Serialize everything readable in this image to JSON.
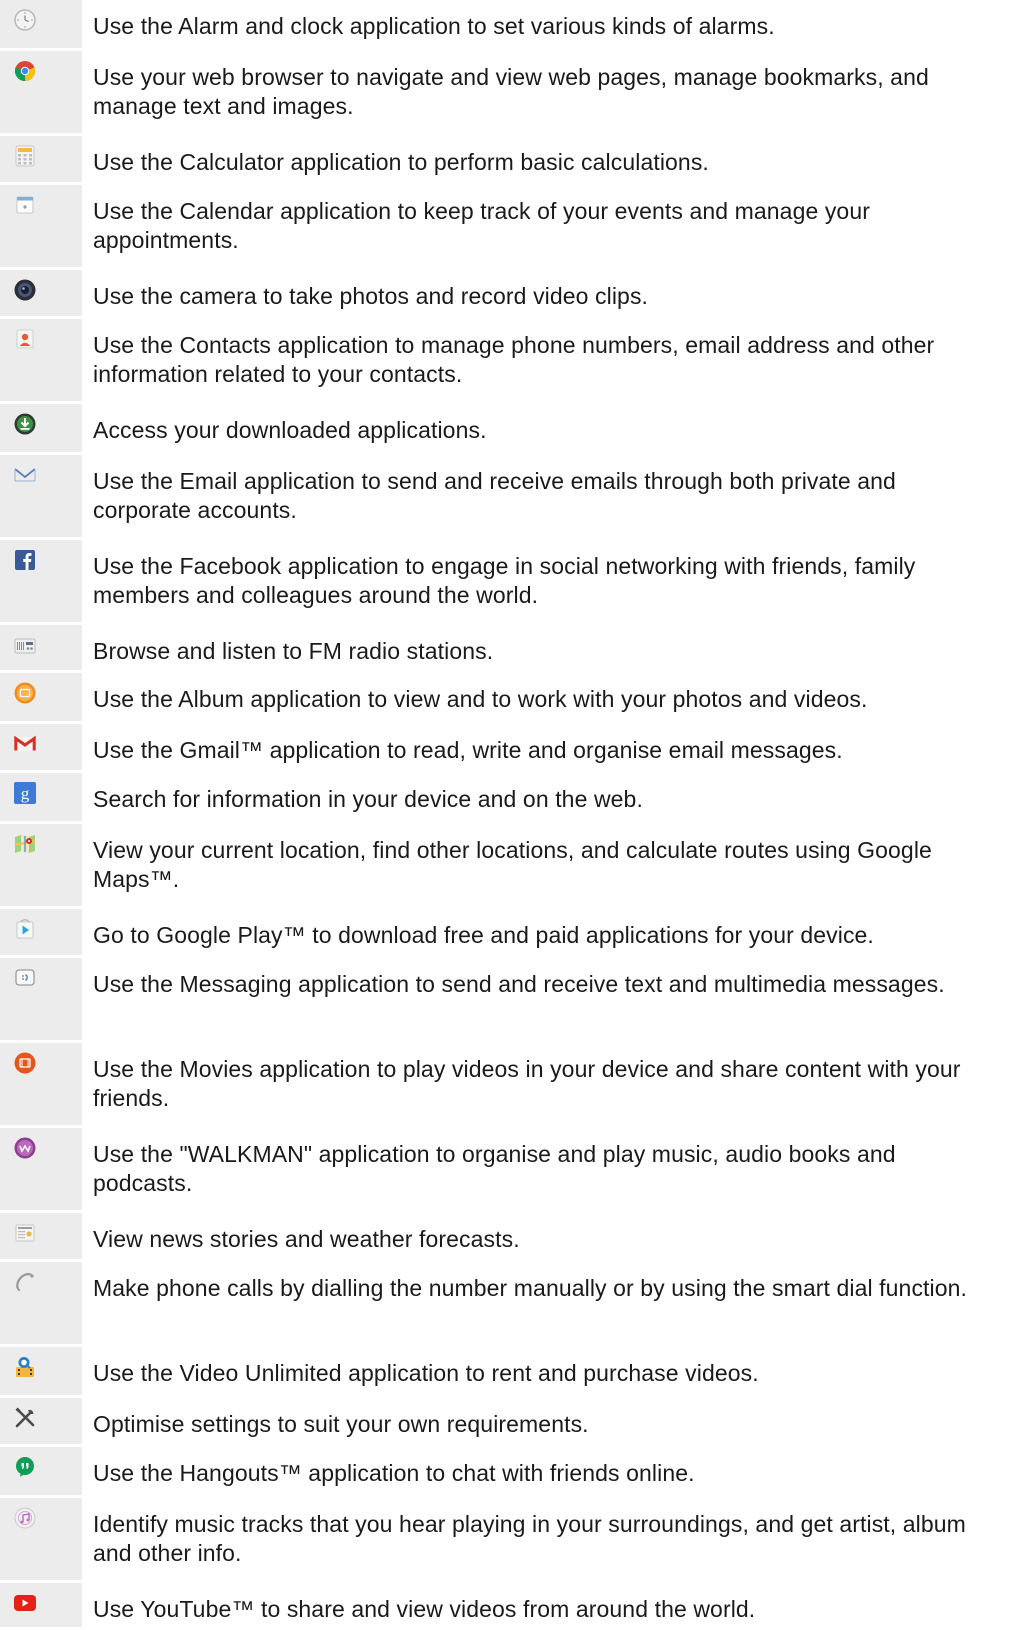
{
  "apps": [
    {
      "icon": "alarm-clock-icon",
      "description": "Use the Alarm and clock application to set various kinds of alarms."
    },
    {
      "icon": "browser-icon",
      "description": "Use your web browser to navigate and view web pages, manage bookmarks, and manage text and images."
    },
    {
      "icon": "calculator-icon",
      "description": "Use the Calculator application to perform basic calculations."
    },
    {
      "icon": "calendar-icon",
      "description": "Use the Calendar application to keep track of your events and manage your appointments."
    },
    {
      "icon": "camera-icon",
      "description": "Use the camera to take photos and record video clips."
    },
    {
      "icon": "contacts-icon",
      "description": "Use the Contacts application to manage phone numbers, email address and other information related to your contacts."
    },
    {
      "icon": "downloads-icon",
      "description": "Access your downloaded applications."
    },
    {
      "icon": "email-icon",
      "description": "Use the Email application to send and receive emails through both private and corporate accounts."
    },
    {
      "icon": "facebook-icon",
      "description": "Use the Facebook application to engage in social networking with friends, family members and colleagues around the world."
    },
    {
      "icon": "fm-radio-icon",
      "description": "Browse and listen to FM radio stations."
    },
    {
      "icon": "album-icon",
      "description": "Use the Album application to view and to work with your photos and videos."
    },
    {
      "icon": "gmail-icon",
      "description": "Use the Gmail™ application to read, write and organise email messages."
    },
    {
      "icon": "google-search-icon",
      "description": "Search for information in your device and on the web."
    },
    {
      "icon": "maps-icon",
      "description": "View your current location, find other locations, and calculate routes using Google Maps™."
    },
    {
      "icon": "play-store-icon",
      "description": "Go to Google Play™ to download free and paid applications for your device."
    },
    {
      "icon": "messaging-icon",
      "description": "Use the Messaging application to send and receive text and multimedia messages."
    },
    {
      "icon": "movies-icon",
      "description": "Use the Movies application to play videos in your device and share content with your friends."
    },
    {
      "icon": "walkman-icon",
      "description": "Use the \"WALKMAN\" application to organise and play music, audio books and podcasts."
    },
    {
      "icon": "news-weather-icon",
      "description": "View news stories and weather forecasts."
    },
    {
      "icon": "phone-icon",
      "description": "Make phone calls by dialling the number manually or by using the smart dial function."
    },
    {
      "icon": "video-unlimited-icon",
      "description": "Use the Video Unlimited application to rent and purchase videos."
    },
    {
      "icon": "settings-icon",
      "description": "Optimise settings to suit your own requirements."
    },
    {
      "icon": "hangouts-icon",
      "description": "Use the Hangouts™ application to chat with friends online."
    },
    {
      "icon": "trackid-icon",
      "description": "Identify music tracks that you hear playing in your surroundings, and get artist, album and other info."
    },
    {
      "icon": "youtube-icon",
      "description": "Use YouTube™ to share and view videos from around the world."
    }
  ]
}
